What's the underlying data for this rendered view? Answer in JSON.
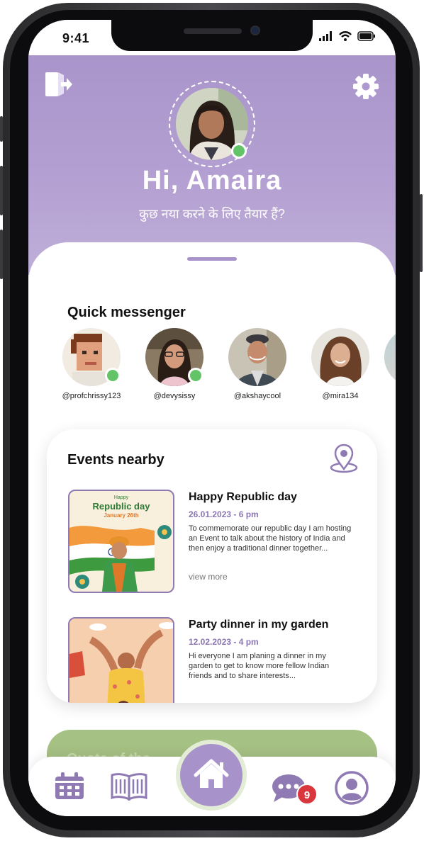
{
  "status_bar": {
    "time": "9:41"
  },
  "header": {
    "greeting": "Hi, Amaira",
    "subtitle": "कुछ नया करने के लिए तैयार हैं?"
  },
  "quick_messenger": {
    "title": "Quick messenger",
    "contacts": [
      {
        "handle": "@profchrissy123",
        "online": true
      },
      {
        "handle": "@devysissy",
        "online": true
      },
      {
        "handle": "@akshaycool",
        "online": false
      },
      {
        "handle": "@mira134",
        "online": false
      }
    ]
  },
  "events": {
    "title": "Events nearby",
    "items": [
      {
        "thumb_text_small": "Happy",
        "thumb_text_main": "Republic day",
        "thumb_text_date": "January 26th",
        "title": "Happy Republic day",
        "date": "26.01.2023 - 6 pm",
        "description": "To commemorate our republic day I am hosting an Event to talk about the history of India and then enjoy a traditional dinner together...",
        "more_label": "view more"
      },
      {
        "title": "Party dinner in my garden",
        "date": "12.02.2023 - 4 pm",
        "description": "Hi everyone I am planing a dinner in my garden to get to know more fellow Indian friends and to share interests..."
      }
    ]
  },
  "quote_card": {
    "label": "Quote of the ..."
  },
  "tab_bar": {
    "message_badge": "9",
    "icons": [
      "calendar-icon",
      "book-icon",
      "home-icon",
      "chat-icon",
      "profile-icon"
    ]
  },
  "colors": {
    "accent": "#a792c9",
    "online": "#62c466",
    "badge": "#d9363e",
    "green_card": "#a6c184"
  }
}
